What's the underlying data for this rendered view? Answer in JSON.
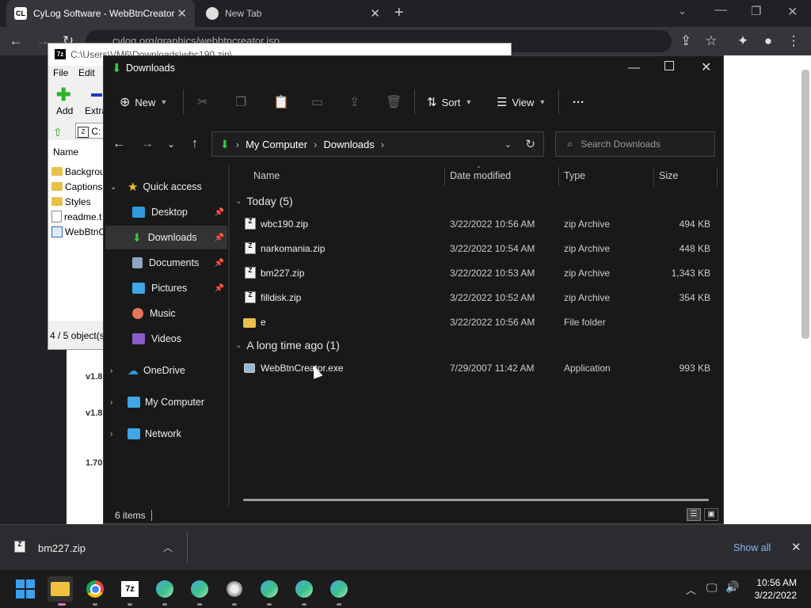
{
  "chrome": {
    "tabs": [
      {
        "favicon": "CL",
        "title": "CyLog Software - WebBtnCreator",
        "active": true
      },
      {
        "favicon": "chrome-globe",
        "title": "New Tab",
        "active": false
      }
    ],
    "url": "cylog.org/graphics/webbtncreator.jsp"
  },
  "webpage": {
    "versions": [
      "v1.8",
      "v1.8",
      "1.70"
    ]
  },
  "sevenzip": {
    "path": "C:\\Users\\VM6\\Downloads\\wbc190.zip\\",
    "menu": [
      "File",
      "Edit"
    ],
    "tools": [
      "Add",
      "Extra"
    ],
    "pathbox": "C:",
    "column": "Name",
    "items": [
      "Backgrou",
      "Captions",
      "Styles",
      "readme.t",
      "WebBtnC"
    ],
    "status": "4 / 5 object(s"
  },
  "explorer": {
    "title": "Downloads",
    "toolbar": {
      "new": "New",
      "sort": "Sort",
      "view": "View",
      "more": "···"
    },
    "address": [
      "My Computer",
      "Downloads"
    ],
    "search_placeholder": "Search Downloads",
    "nav": {
      "quick_access": "Quick access",
      "items": [
        "Desktop",
        "Downloads",
        "Documents",
        "Pictures",
        "Music",
        "Videos"
      ],
      "onedrive": "OneDrive",
      "mycomputer": "My Computer",
      "network": "Network"
    },
    "columns": [
      "Name",
      "Date modified",
      "Type",
      "Size"
    ],
    "groups": [
      {
        "label": "Today (5)",
        "files": [
          {
            "name": "wbc190.zip",
            "date": "3/22/2022 10:56 AM",
            "type": "zip Archive",
            "size": "494 KB"
          },
          {
            "name": "narkomania.zip",
            "date": "3/22/2022 10:54 AM",
            "type": "zip Archive",
            "size": "448 KB"
          },
          {
            "name": "bm227.zip",
            "date": "3/22/2022 10:53 AM",
            "type": "zip Archive",
            "size": "1,343 KB"
          },
          {
            "name": "filldisk.zip",
            "date": "3/22/2022 10:52 AM",
            "type": "zip Archive",
            "size": "354 KB"
          },
          {
            "name": "e",
            "date": "3/22/2022 10:56 AM",
            "type": "File folder",
            "size": ""
          }
        ]
      },
      {
        "label": "A long time ago (1)",
        "files": [
          {
            "name": "WebBtnCreator.exe",
            "date": "7/29/2007 11:42 AM",
            "type": "Application",
            "size": "993 KB"
          }
        ]
      }
    ],
    "status": "6 items"
  },
  "downloads_bar": {
    "file": "bm227.zip",
    "show_all": "Show all"
  },
  "taskbar": {
    "time": "10:56 AM",
    "date": "3/22/2022"
  },
  "colors": {
    "accent_green": "#3cc54a",
    "folder": "#e8c04a",
    "link_blue": "#8ab4f8"
  }
}
